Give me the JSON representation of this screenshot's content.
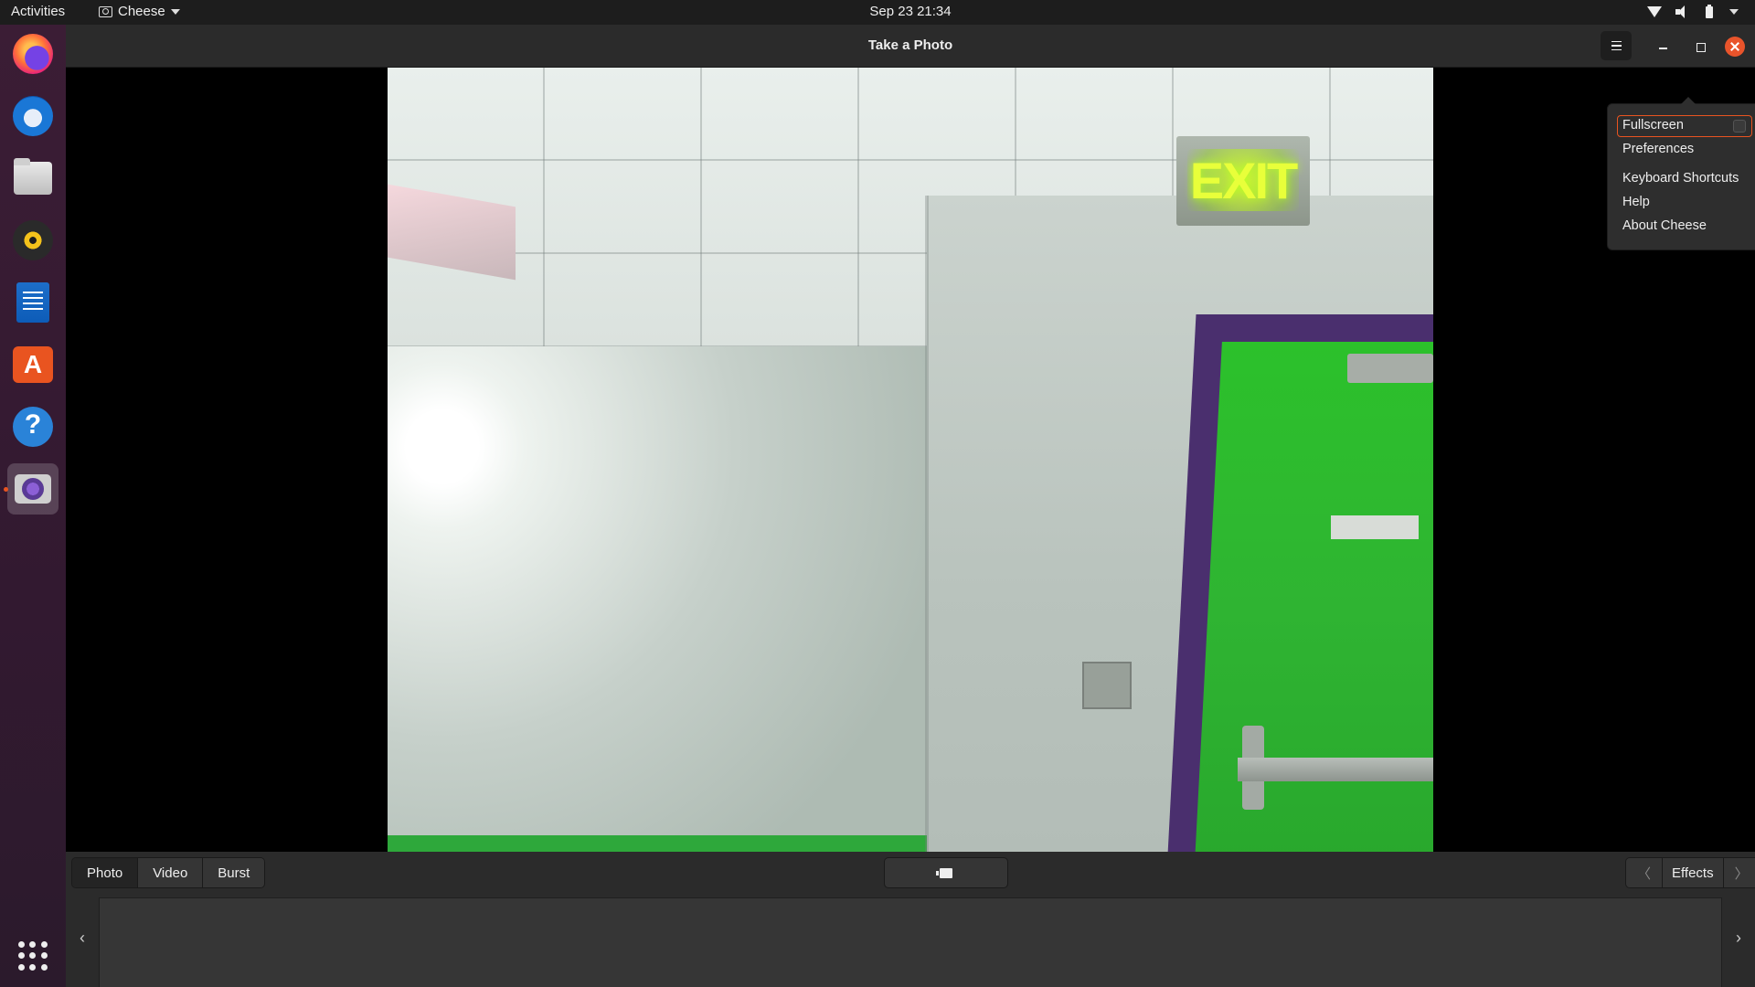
{
  "topbar": {
    "activities": "Activities",
    "app_name": "Cheese",
    "clock": "Sep 23  21:34"
  },
  "dock": {
    "items": [
      "firefox-icon",
      "thunderbird-icon",
      "files-icon",
      "rhythmbox-icon",
      "libreoffice-writer-icon",
      "app-center-icon",
      "help-icon",
      "cheese-icon"
    ],
    "active_item": "cheese-icon"
  },
  "window": {
    "title": "Take a Photo"
  },
  "feed": {
    "sign_text": "EXIT"
  },
  "menu": {
    "fullscreen": "Fullscreen",
    "preferences": "Preferences",
    "keyboard_shortcuts": "Keyboard Shortcuts",
    "help": "Help",
    "about": "About Cheese"
  },
  "toolbar": {
    "modes": [
      "Photo",
      "Video",
      "Burst"
    ],
    "active_mode": "Photo",
    "effects_label": "Effects",
    "prev_arrow": "〈",
    "next_arrow": "〉"
  },
  "thumbnails": {
    "prev_arrow": "‹",
    "next_arrow": "›"
  },
  "colors": {
    "accent": "#e95420",
    "door_green": "#2fb432",
    "exit_glow": "#e8ff3a"
  }
}
